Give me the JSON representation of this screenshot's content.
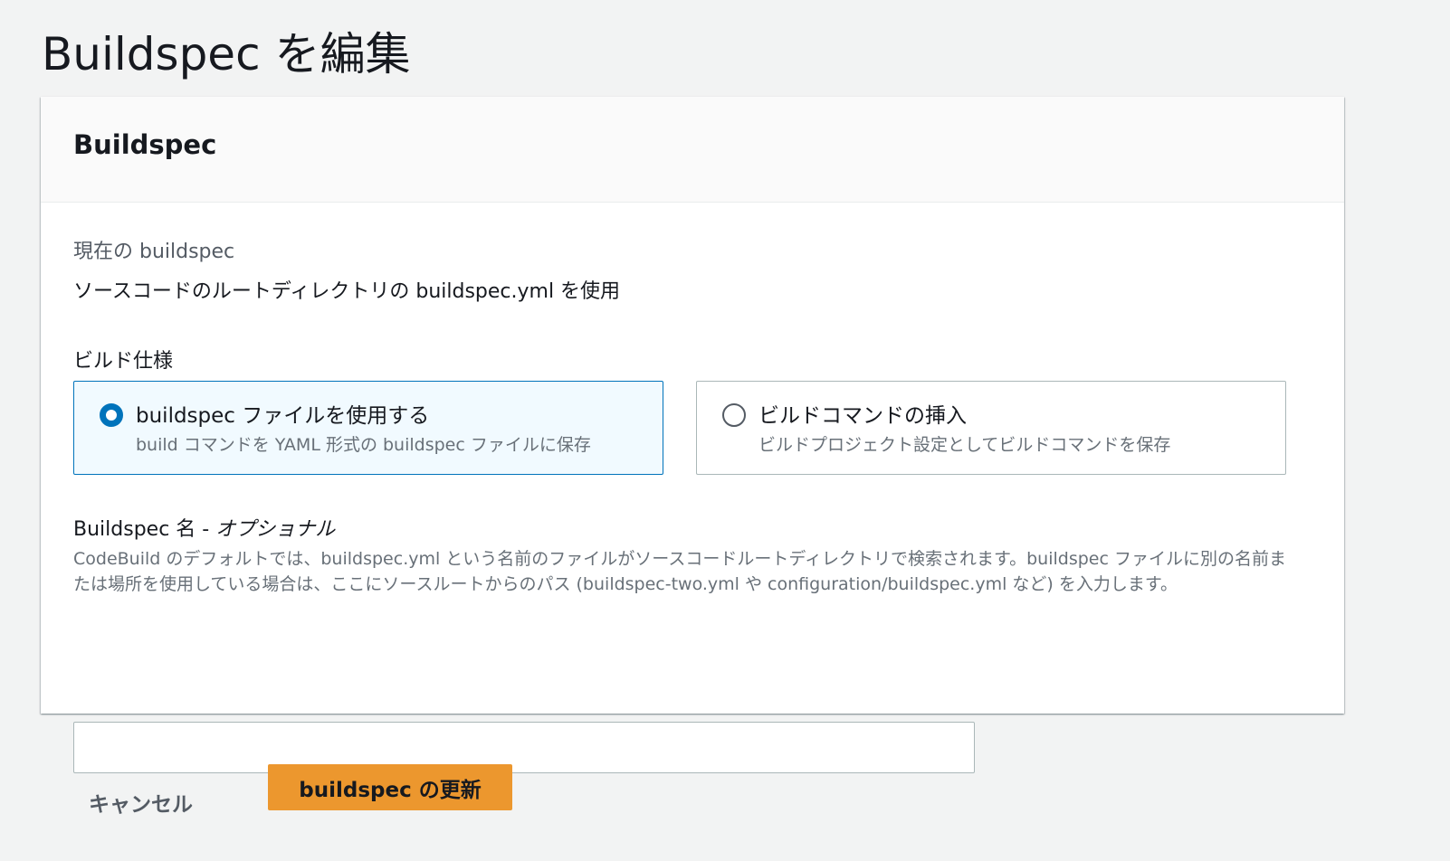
{
  "page": {
    "title": "Buildspec を編集"
  },
  "panel": {
    "header": "Buildspec",
    "current_label": "現在の buildspec",
    "current_value": "ソースコードのルートディレクトリの buildspec.yml を使用",
    "spec_label": "ビルド仕様",
    "options": [
      {
        "title": "buildspec ファイルを使用する",
        "description": "build コマンドを YAML 形式の buildspec ファイルに保存",
        "selected": true
      },
      {
        "title": "ビルドコマンドの挿入",
        "description": "ビルドプロジェクト設定としてビルドコマンドを保存",
        "selected": false
      }
    ],
    "name_label": "Buildspec 名 - ",
    "name_optional": "オプショナル",
    "name_description": "CodeBuild のデフォルトでは、buildspec.yml という名前のファイルがソースコードルートディレクトリで検索されます。buildspec ファイルに別の名前または場所を使用している場合は、ここにソースルートからのパス (buildspec-two.yml や configuration/buildspec.yml など) を入力します。",
    "name_value": ""
  },
  "actions": {
    "cancel_label": "キャンセル",
    "submit_label": "buildspec の更新"
  },
  "colors": {
    "accent": "#0073bb",
    "primary_button": "#ec972e",
    "background": "#f2f3f3"
  }
}
